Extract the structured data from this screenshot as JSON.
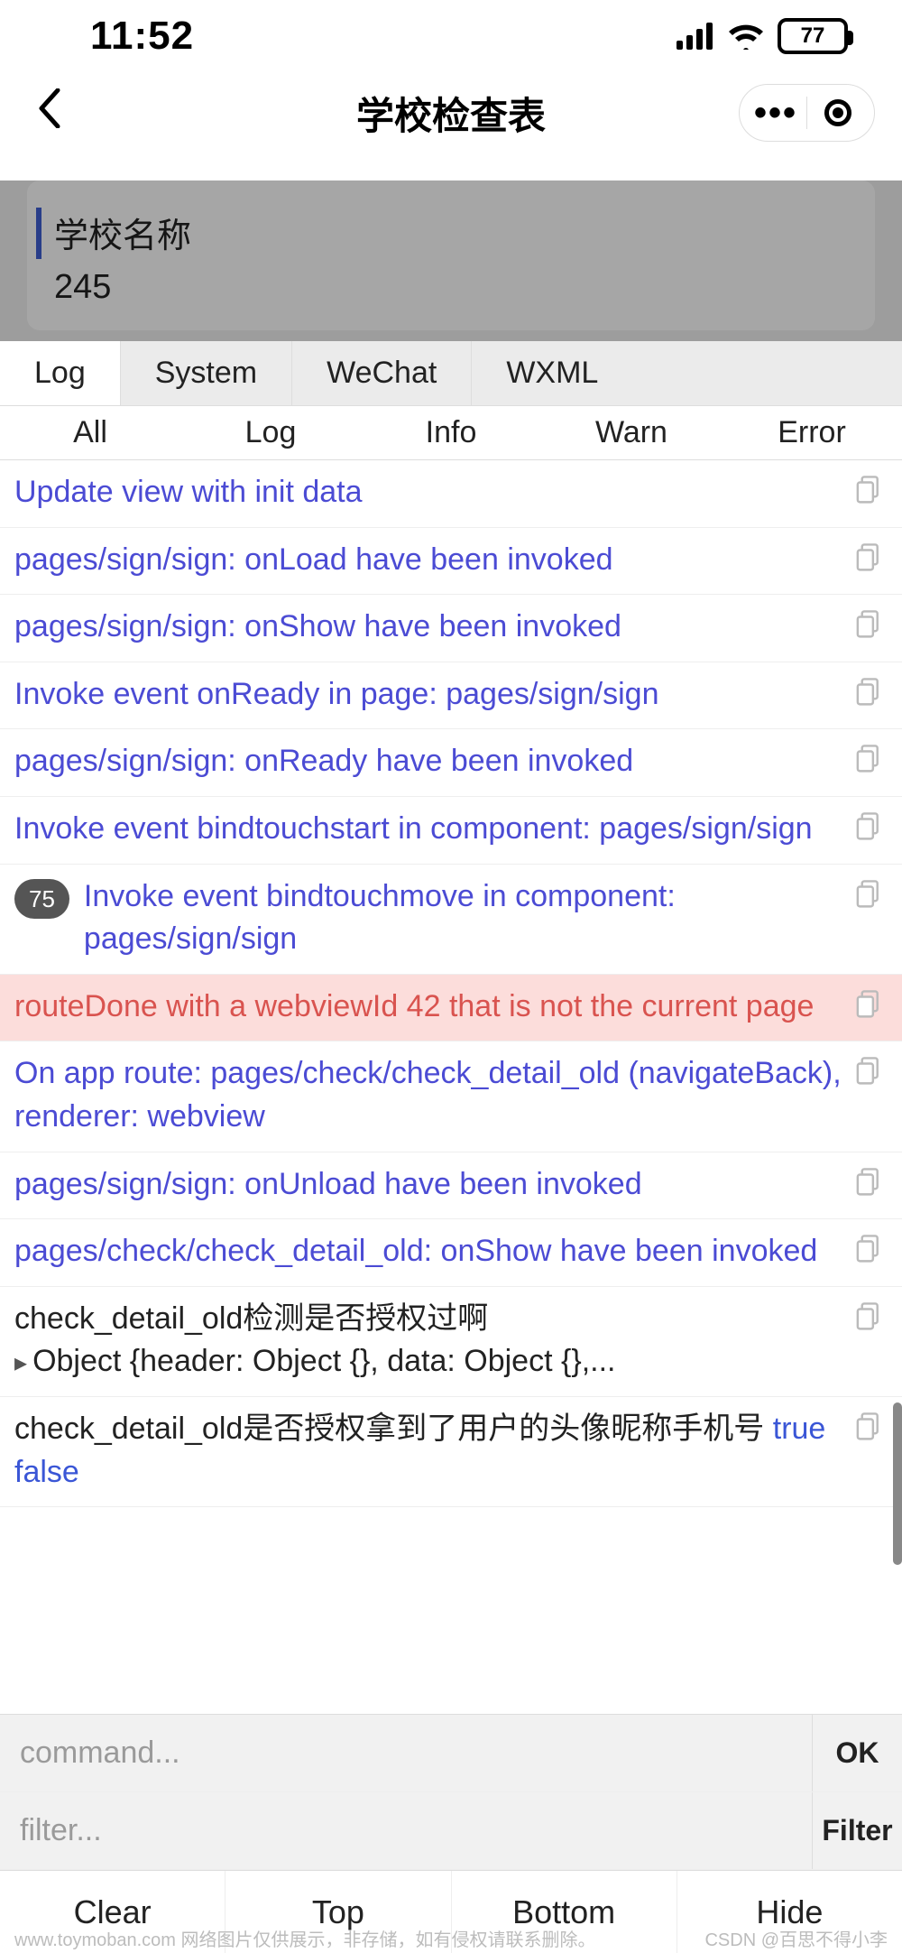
{
  "status": {
    "time": "11:52",
    "battery_pct": "77",
    "battery_fill_pct": 77
  },
  "nav": {
    "title": "学校检查表"
  },
  "page": {
    "card1_title": "学校名称",
    "card1_value": "245"
  },
  "vconsole": {
    "main_tabs": [
      "Log",
      "System",
      "WeChat",
      "WXML"
    ],
    "active_main": 0,
    "sub_tabs": [
      "All",
      "Log",
      "Info",
      "Warn",
      "Error"
    ],
    "rows": [
      {
        "type": "info",
        "text": "Update view with init data"
      },
      {
        "type": "info",
        "text": "pages/sign/sign: onLoad have been invoked"
      },
      {
        "type": "info",
        "text": "pages/sign/sign: onShow have been invoked"
      },
      {
        "type": "info",
        "text": "Invoke event onReady in page: pages/sign/sign"
      },
      {
        "type": "info",
        "text": "pages/sign/sign: onReady have been invoked"
      },
      {
        "type": "info",
        "text": "Invoke event bindtouchstart in component: pages/sign/sign"
      },
      {
        "type": "info",
        "badge": "75",
        "text": "Invoke event bindtouchmove in component: pages/sign/sign"
      },
      {
        "type": "warn",
        "text": "routeDone with a webviewId 42 that is not the current page"
      },
      {
        "type": "info",
        "text": "On app route: pages/check/check_detail_old (navigateBack), renderer: webview"
      },
      {
        "type": "info",
        "text": "pages/sign/sign: onUnload have been invoked"
      },
      {
        "type": "info",
        "text": "pages/check/check_detail_old: onShow have been invoked"
      },
      {
        "type": "log",
        "text": "check_detail_old检测是否授权过啊",
        "object": "Object {header: Object {}, data: Object {},..."
      },
      {
        "type": "log",
        "text": "check_detail_old是否授权拿到了用户的头像昵称手机号 ",
        "trailing_bools": [
          "true",
          "false"
        ]
      }
    ],
    "command_placeholder": "command...",
    "filter_placeholder": "filter...",
    "ok_label": "OK",
    "filter_label": "Filter",
    "bottom_buttons": [
      "Clear",
      "Top",
      "Bottom",
      "Hide"
    ]
  },
  "footer": {
    "left": "www.toymoban.com 网络图片仅供展示，非存储，如有侵权请联系删除。",
    "right": "CSDN @百思不得小李"
  }
}
